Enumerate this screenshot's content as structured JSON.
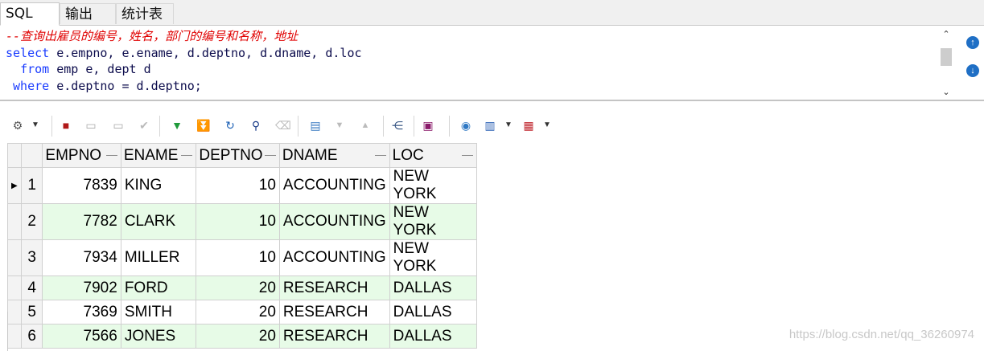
{
  "tabs": [
    "SQL",
    "输出",
    "统计表"
  ],
  "editor": {
    "comment": "--查询出雇员的编号，姓名，部门的编号和名称，地址",
    "line2_kw": "select",
    "line2_rest": " e.empno, e.ename, d.deptno, d.dname, d.loc",
    "line3_kw": "from",
    "line3_rest": " emp e, dept d",
    "line4_kw": "where",
    "line4_rest": " e.deptno = d.deptno;"
  },
  "side_buttons": {
    "up": "↑",
    "down": "↓"
  },
  "toolbar": {
    "icons": [
      "settings-dropdown-icon",
      "lock-icon",
      "new-record-icon",
      "delete-record-icon",
      "post-check-icon",
      "fetch-next-icon",
      "fetch-last-icon",
      "refresh-icon",
      "find-icon",
      "clear-icon",
      "query-by-example-icon",
      "sort-down-icon",
      "sort-up-icon",
      "export-tree-icon",
      "save-icon",
      "connect-icon",
      "chart-icon",
      "grid-view-icon"
    ]
  },
  "grid": {
    "columns": [
      "EMPNO",
      "ENAME",
      "DEPTNO",
      "DNAME",
      "LOC"
    ],
    "rows": [
      {
        "n": "1",
        "empno": "7839",
        "ename": "KING",
        "deptno": "10",
        "dname": "ACCOUNTING",
        "loc": "NEW YORK"
      },
      {
        "n": "2",
        "empno": "7782",
        "ename": "CLARK",
        "deptno": "10",
        "dname": "ACCOUNTING",
        "loc": "NEW YORK"
      },
      {
        "n": "3",
        "empno": "7934",
        "ename": "MILLER",
        "deptno": "10",
        "dname": "ACCOUNTING",
        "loc": "NEW YORK"
      },
      {
        "n": "4",
        "empno": "7902",
        "ename": "FORD",
        "deptno": "20",
        "dname": "RESEARCH",
        "loc": "DALLAS"
      },
      {
        "n": "5",
        "empno": "7369",
        "ename": "SMITH",
        "deptno": "20",
        "dname": "RESEARCH",
        "loc": "DALLAS"
      },
      {
        "n": "6",
        "empno": "7566",
        "ename": "JONES",
        "deptno": "20",
        "dname": "RESEARCH",
        "loc": "DALLAS"
      }
    ]
  },
  "watermark": "https://blog.csdn.net/qq_36260974",
  "colors": {
    "keyword": "#1a3cff",
    "comment": "#e00000",
    "alt_row": "#e7fbe7",
    "button_blue": "#1f6fc5"
  }
}
